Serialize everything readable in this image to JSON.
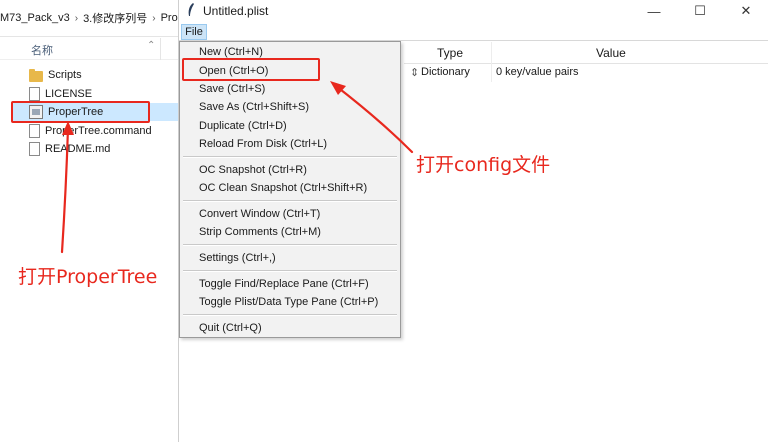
{
  "explorer": {
    "breadcrumb": [
      "M73_Pack_v3",
      "3.修改序列号",
      "Pro"
    ],
    "column_header": "名称",
    "files": [
      {
        "name": "Scripts",
        "icon": "folder-icon"
      },
      {
        "name": "LICENSE",
        "icon": "document-icon"
      },
      {
        "name": "ProperTree",
        "icon": "app-icon",
        "selected": true
      },
      {
        "name": "ProperTree.command",
        "icon": "document-icon"
      },
      {
        "name": "README.md",
        "icon": "document-icon"
      }
    ]
  },
  "plist_window": {
    "title": "Untitled.plist",
    "menu_file": "File",
    "columns": {
      "type": "Type",
      "value": "Value"
    },
    "root_row": {
      "type": "Dictionary",
      "value": "0 key/value pairs"
    },
    "controls": {
      "minimize": "—",
      "maximize": "☐",
      "close": "✕"
    }
  },
  "file_menu": {
    "items": [
      "New (Ctrl+N)",
      "Open (Ctrl+O)",
      "Save (Ctrl+S)",
      "Save As (Ctrl+Shift+S)",
      "Duplicate (Ctrl+D)",
      "Reload From Disk (Ctrl+L)",
      "OC Snapshot (Ctrl+R)",
      "OC Clean Snapshot (Ctrl+Shift+R)",
      "Convert Window (Ctrl+T)",
      "Strip Comments (Ctrl+M)",
      "Settings (Ctrl+,)",
      "Toggle Find/Replace Pane (Ctrl+F)",
      "Toggle Plist/Data Type Pane (Ctrl+P)",
      "Quit (Ctrl+Q)"
    ]
  },
  "annotations": {
    "open_config": "打开config文件",
    "open_propertree": "打开ProperTree"
  },
  "colors": {
    "annotation_red": "#e8281e",
    "selection_blue": "#cce8ff",
    "menu_bg": "#f2f2f2"
  }
}
